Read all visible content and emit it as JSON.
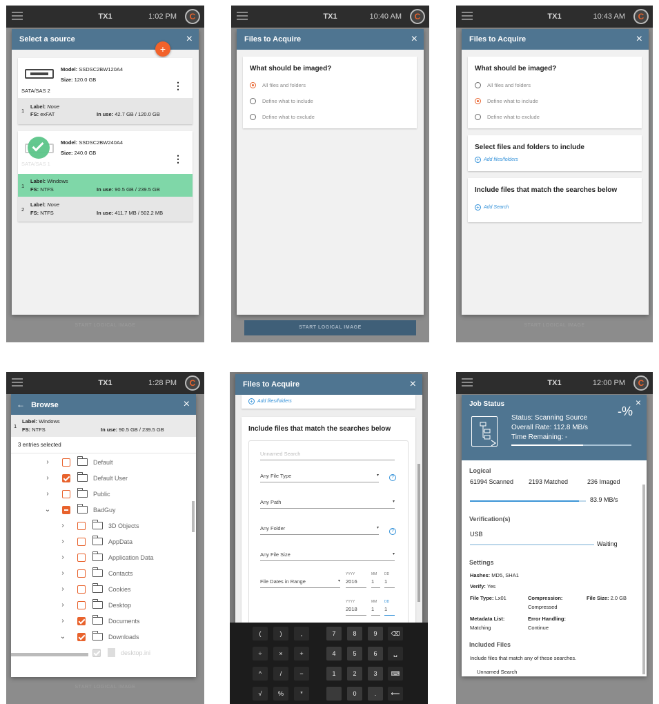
{
  "panels": {
    "p1": {
      "device": "TX1",
      "time": "1:02 PM",
      "logo": "C",
      "ghost": "START LOGICAL IMAGE",
      "title": "Select a source",
      "close": "×",
      "fab": "+",
      "drive1": {
        "model_label": "Model:",
        "model": "SSDSC2BW120A4",
        "size_label": "Size:",
        "size": "120.0 GB",
        "bus": "SATA/SAS 2",
        "part": {
          "num": "1",
          "label_label": "Label:",
          "label": "None",
          "fs_label": "FS:",
          "fs": "exFAT",
          "use_label": "In use:",
          "use": "42.7 GB / 120.0 GB"
        }
      },
      "drive2": {
        "model_label": "Model:",
        "model": "SSDSC2BW240A4",
        "size_label": "Size:",
        "size": "240.0 GB",
        "bus": "SATA/SAS 1",
        "parts": [
          {
            "num": "1",
            "label_label": "Label:",
            "label": "Windows",
            "fs_label": "FS:",
            "fs": "NTFS",
            "use_label": "In use:",
            "use": "90.5 GB / 239.5 GB"
          },
          {
            "num": "2",
            "label_label": "Label:",
            "label": "None",
            "fs_label": "FS:",
            "fs": "NTFS",
            "use_label": "In use:",
            "use": "411.7 MB / 502.2 MB"
          }
        ]
      },
      "kebab": "⋮"
    },
    "p2": {
      "device": "TX1",
      "time": "10:40 AM",
      "logo": "C",
      "title": "Files to Acquire",
      "close": "×",
      "question": "What should be imaged?",
      "options": [
        "All files and folders",
        "Define what to include",
        "Define what to exclude"
      ],
      "start": "START LOGICAL IMAGE"
    },
    "p3": {
      "device": "TX1",
      "time": "10:43 AM",
      "logo": "C",
      "title": "Files to Acquire",
      "close": "×",
      "question": "What should be imaged?",
      "options": [
        "All files and folders",
        "Define what to include",
        "Define what to exclude"
      ],
      "select_title": "Select files and folders to include",
      "add_files": "Add files/folders",
      "include_title": "Include files that match the searches below",
      "add_search": "Add Search",
      "ghost": "START LOGICAL IMAGE"
    },
    "p4": {
      "device": "TX1",
      "time": "1:28 PM",
      "logo": "C",
      "title": "Browse",
      "back": "←",
      "close": "×",
      "part": {
        "num": "1",
        "label_label": "Label:",
        "label": "Windows",
        "fs_label": "FS:",
        "fs": "NTFS",
        "use_label": "In use:",
        "use": "90.5 GB / 239.5 GB"
      },
      "selected": "3 entries selected",
      "tree": [
        {
          "name": "Default",
          "state": "empty",
          "chev": "›",
          "lvl": 0
        },
        {
          "name": "Default User",
          "state": "checked",
          "chev": "›",
          "lvl": 0
        },
        {
          "name": "Public",
          "state": "empty",
          "chev": "›",
          "lvl": 0
        },
        {
          "name": "BadGuy",
          "state": "partial",
          "chev": "⌄",
          "lvl": 0
        },
        {
          "name": "3D Objects",
          "state": "empty",
          "chev": "›",
          "lvl": 1
        },
        {
          "name": "AppData",
          "state": "empty",
          "chev": "›",
          "lvl": 1
        },
        {
          "name": "Application Data",
          "state": "empty",
          "chev": "›",
          "lvl": 1
        },
        {
          "name": "Contacts",
          "state": "empty",
          "chev": "›",
          "lvl": 1
        },
        {
          "name": "Cookies",
          "state": "empty",
          "chev": "›",
          "lvl": 1
        },
        {
          "name": "Desktop",
          "state": "empty",
          "chev": "›",
          "lvl": 1
        },
        {
          "name": "Documents",
          "state": "checked",
          "chev": "›",
          "lvl": 1
        },
        {
          "name": "Downloads",
          "state": "checked",
          "chev": "⌄",
          "lvl": 1
        },
        {
          "name": "desktop.ini",
          "state": "grey",
          "chev": "",
          "lvl": 2
        }
      ],
      "ghost": "START LOGICAL IMAGE"
    },
    "p5": {
      "title": "Files to Acquire",
      "close": "×",
      "add_files": "Add files/folders",
      "include_title": "Include files that match the searches below",
      "search_name": "Unnamed Search",
      "file_type": "Any File Type",
      "path": "Any Path",
      "folder": "Any Folder",
      "file_size": "Any File Size",
      "dates": "File Dates in Range",
      "yyyy": "YYYY",
      "mm": "MM",
      "dd": "DD",
      "from": {
        "y": "2016",
        "m": "1",
        "d": "1"
      },
      "to": {
        "y": "2018",
        "m": "1",
        "d": "1"
      },
      "help": "?",
      "keys": [
        [
          "(",
          ")",
          ",",
          "7",
          "8",
          "9",
          "⌫"
        ],
        [
          "÷",
          "×",
          "+",
          "4",
          "5",
          "6",
          "␣"
        ],
        [
          "^",
          "/",
          "−",
          "1",
          "2",
          "3",
          "⌨"
        ],
        [
          "√",
          "%",
          "*",
          "",
          "0",
          ".",
          "⟵"
        ]
      ]
    },
    "p6": {
      "device": "TX1",
      "time": "12:00 PM",
      "logo": "C",
      "title": "Job Status",
      "close": "×",
      "status": "Status: Scanning Source",
      "rate": "Overall Rate: 112.8 MB/s",
      "remaining": "Time Remaining: -",
      "percent": "-%",
      "progress": 0.6,
      "logical_title": "Logical",
      "scanned": "61994 Scanned",
      "matched": "2193 Matched",
      "imaged": "236 Imaged",
      "logical_rate": "83.9 MB/s",
      "verif_title": "Verification(s)",
      "usb": "USB",
      "waiting": "Waiting",
      "settings_title": "Settings",
      "hashes_label": "Hashes:",
      "hashes": "MD5, SHA1",
      "verify_label": "Verify:",
      "verify": "Yes",
      "filetype_label": "File Type:",
      "filetype": "Lx01",
      "compression_label": "Compression:",
      "compression": "Compressed",
      "filesize_label": "File Size:",
      "filesize": "2.0 GB",
      "metadata_label": "Metadata List:",
      "metadata": "Matching",
      "error_label": "Error Handling:",
      "error": "Continue",
      "included_title": "Included Files",
      "included_desc": "Include files that match any of these searches.",
      "search_name": "Unnamed Search"
    }
  }
}
